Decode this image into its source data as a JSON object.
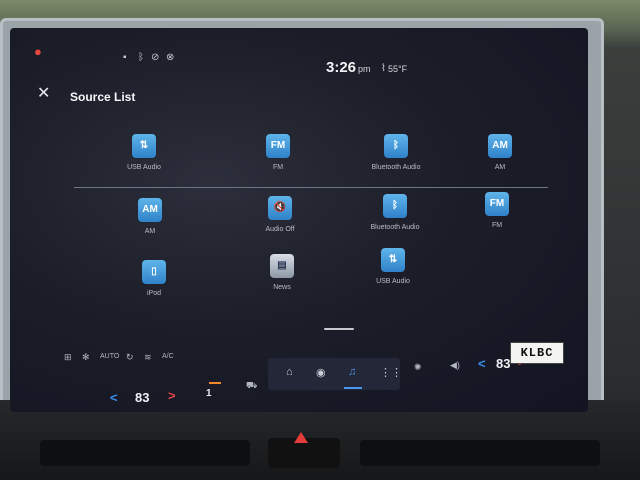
{
  "status_bar": {
    "time": "3:26",
    "ampm": "pm",
    "temperature": "55°F",
    "icons": [
      "alert-icon",
      "message-icon",
      "bluetooth-icon",
      "no-signal-icon",
      "wifi-off-icon"
    ]
  },
  "header": {
    "close_glyph": "✕",
    "title": "Source List"
  },
  "sources_row1": [
    {
      "label": "USB Audio",
      "glyph": "⇅"
    },
    {
      "label": "FM",
      "glyph": "FM"
    },
    {
      "label": "Bluetooth Audio",
      "glyph": "ᛒ"
    },
    {
      "label": "AM",
      "glyph": "AM"
    }
  ],
  "sources_row2": [
    {
      "label": "AM",
      "glyph": "AM"
    },
    {
      "label": "Audio Off",
      "glyph": "🔇"
    },
    {
      "label": "Bluetooth Audio",
      "glyph": "ᛒ"
    },
    {
      "label": "FM",
      "glyph": "FM"
    }
  ],
  "sources_row3": [
    {
      "label": "iPod",
      "glyph": "▯"
    },
    {
      "label": "News",
      "glyph": "▤"
    },
    {
      "label": "USB Audio",
      "glyph": "⇅"
    }
  ],
  "bottom_bar": {
    "climate_auto": "AUTO",
    "climate_ac": "A/C",
    "driver_temp": "83",
    "passenger_temp": "83",
    "seat_label": "1",
    "nav_items": [
      "home-icon",
      "nav-pin-icon",
      "music-icon",
      "apps-icon"
    ],
    "active_nav": "music-icon"
  },
  "sticker_text": "KLBC",
  "colors": {
    "accent_blue": "#4a97f0",
    "temp_down": "#3a8de8",
    "temp_up": "#e44848",
    "alert": "#e7453f"
  }
}
